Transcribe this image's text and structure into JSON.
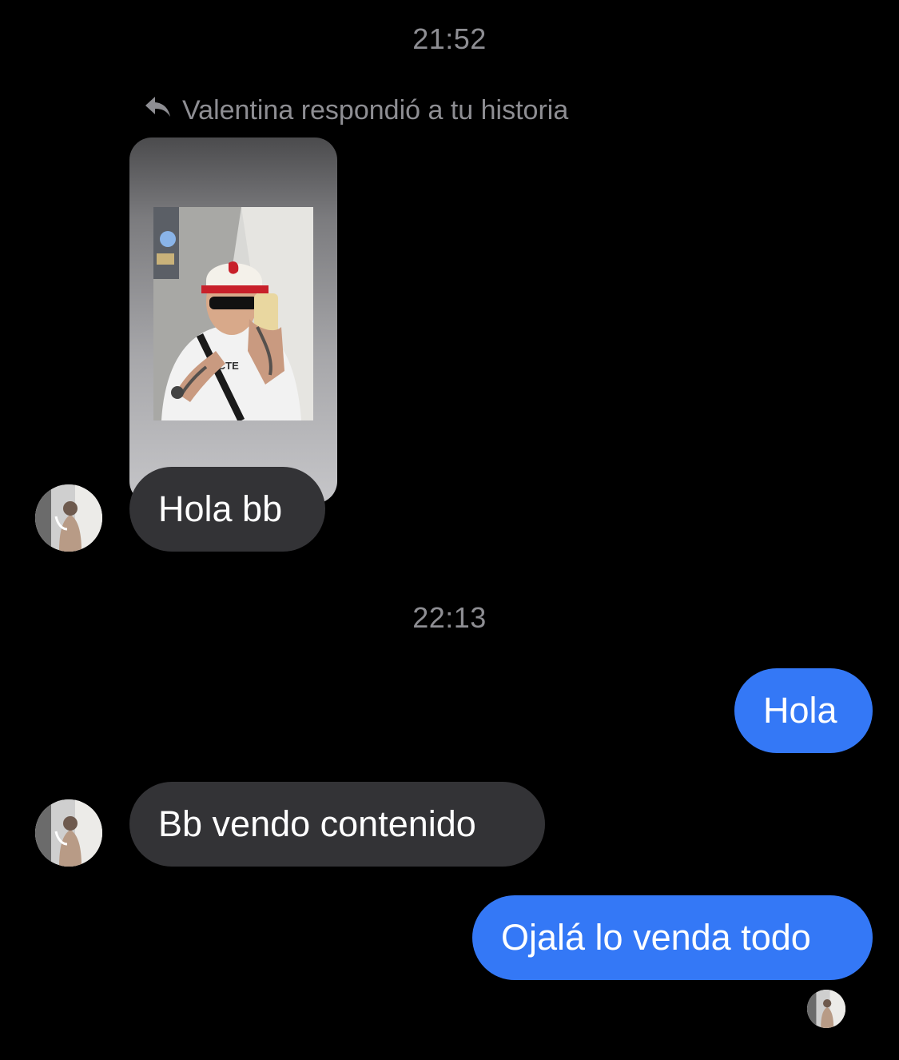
{
  "conversation": {
    "timestamp_1": "21:52",
    "reply_note": "Valentina respondió a tu historia",
    "story_reply": {
      "photo_shirt_text": "ABCTE"
    },
    "messages": [
      {
        "direction": "incoming",
        "text": "Hola bb"
      },
      {
        "direction": "outgoing",
        "text": "Hola"
      },
      {
        "direction": "incoming",
        "text": "Bb vendo contenido"
      },
      {
        "direction": "outgoing",
        "text": "Ojalá lo venda todo"
      }
    ],
    "timestamp_2": "22:13"
  },
  "colors": {
    "background": "#000000",
    "incoming_bubble": "#333336",
    "outgoing_bubble": "#3478f6",
    "meta_text": "#8e8e93"
  },
  "icons": {
    "reply": "reply-arrow-icon"
  }
}
